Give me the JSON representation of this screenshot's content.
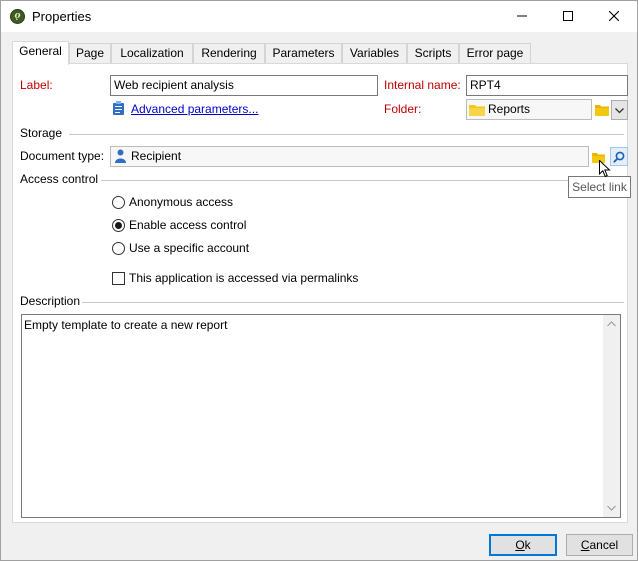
{
  "window": {
    "title": "Properties",
    "app_icon": "leaf-badge-icon"
  },
  "tabs": [
    {
      "label": "General",
      "active": true
    },
    {
      "label": "Page"
    },
    {
      "label": "Localization"
    },
    {
      "label": "Rendering"
    },
    {
      "label": "Parameters"
    },
    {
      "label": "Variables"
    },
    {
      "label": "Scripts"
    },
    {
      "label": "Error page"
    }
  ],
  "general": {
    "label_caption": "Label:",
    "label_value": "Web recipient analysis",
    "advanced_link": "Advanced parameters...",
    "internal_name_caption": "Internal name:",
    "internal_name_value": "RPT4",
    "folder_caption": "Folder:",
    "folder_value": "Reports"
  },
  "storage": {
    "section_title": "Storage",
    "document_type_caption": "Document type:",
    "document_type_value": "Recipient"
  },
  "tooltip": "Select link",
  "access_control": {
    "section_title": "Access control",
    "options": [
      "Anonymous access",
      "Enable access control",
      "Use a specific account"
    ],
    "selected": "Enable access control",
    "permalinks_label": "This application is accessed via permalinks",
    "permalinks_checked": false
  },
  "description": {
    "section_title": "Description",
    "text": "Empty template to create a new report"
  },
  "buttons": {
    "ok_prefix": "",
    "ok_mnemonic": "O",
    "ok_rest": "k",
    "cancel_prefix": "",
    "cancel_mnemonic": "C",
    "cancel_rest": "ancel"
  },
  "colors": {
    "required_label": "#c00000",
    "link": "#0000cc",
    "folder": "#f2c811",
    "default_button_border": "#0078d7"
  }
}
